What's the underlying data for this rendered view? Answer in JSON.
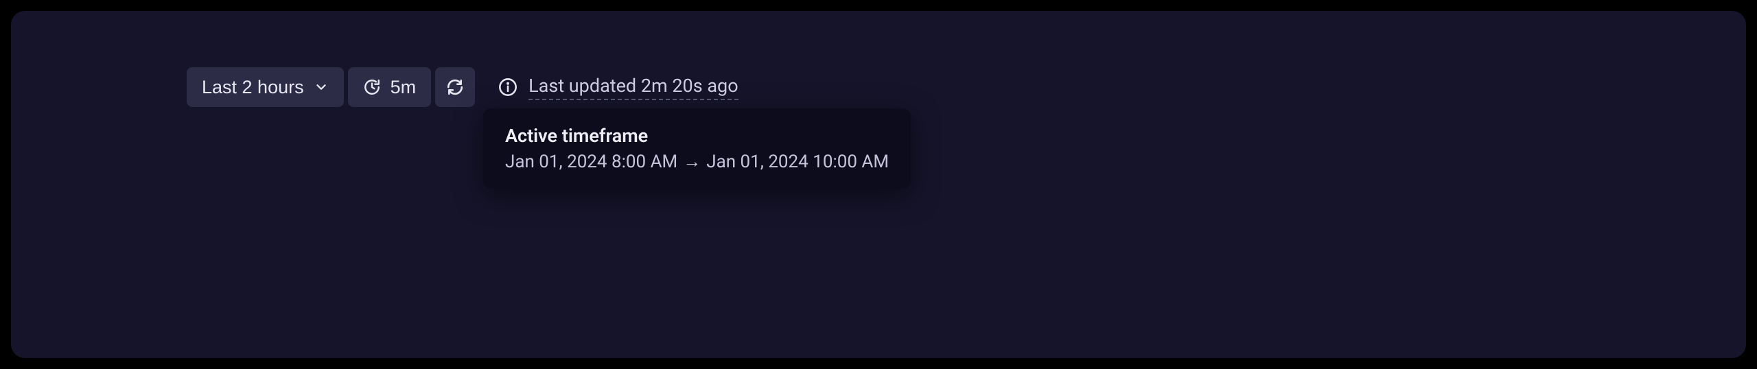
{
  "toolbar": {
    "timerange_label": "Last 2 hours",
    "interval_label": "5m"
  },
  "status": {
    "last_updated_text": "Last updated 2m 20s ago"
  },
  "tooltip": {
    "title": "Active timeframe",
    "from": "Jan 01, 2024 8:00 AM",
    "arrow": "→",
    "to": "Jan 01, 2024 10:00 AM"
  }
}
